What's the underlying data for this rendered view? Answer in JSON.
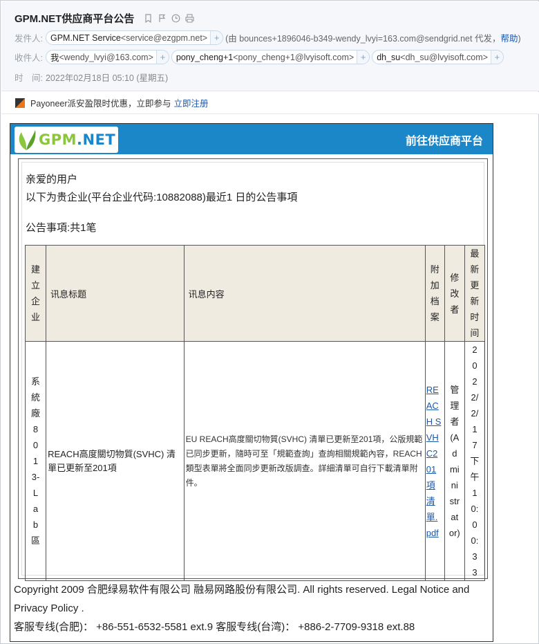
{
  "subject": "GPM.NET供应商平台公告",
  "header": {
    "from_label": "发件人:",
    "from": {
      "name": "GPM.NET Service",
      "email": "<service@ezgpm.net>"
    },
    "via_text": "(由 bounces+1896046-b349-wendy_lvyi=163.com@sendgrid.net 代发，",
    "help_link": "帮助",
    "via_close": ")",
    "to_label": "收件人:",
    "recipients": [
      {
        "name": "我",
        "email": "<wendy_lvyi@163.com>"
      },
      {
        "name": "pony_cheng+1",
        "email": "<pony_cheng+1@lvyisoft.com>"
      },
      {
        "name": "dh_su",
        "email": "<dh_su@lvyisoft.com>"
      }
    ],
    "time_label": "时　间:",
    "time_value": "2022年02月18日 05:10 (星期五)"
  },
  "promo": {
    "text": "Payoneer派安盈限时优惠，立即参与",
    "link": "立即注册"
  },
  "banner": {
    "logo_text_a": "GPM",
    "logo_text_b": ".NET",
    "go_label": "前往供应商平台"
  },
  "body": {
    "greeting": "亲爱的用户",
    "intro": "以下为贵企业(平台企业代码:10882088)最近1 日的公告事項",
    "count": "公告事項:共1笔"
  },
  "table": {
    "headers": [
      "建立企业",
      "讯息标题",
      "讯息内容",
      "附加档案",
      "修改者",
      "最新更新时间"
    ],
    "row": {
      "company": "系統廠8013-Lab區",
      "title": "REACH高度關切物質(SVHC) 清單已更新至201項",
      "content": "EU REACH高度關切物質(SVHC) 清單已更新至201項，公版規範已同步更新，隨時可至「規範查詢」查詢相關規範內容，REACH類型表單將全面同步更新改版調查。詳細清單可自行下載清單附件。",
      "attachment": "REACH SVHC201項清單.pdf",
      "modifier": "管理者(Administrator)",
      "updated": "2022/2/17 下午10:00:33"
    }
  },
  "footer": {
    "copyright": "Copyright 2009 合肥绿易软件有限公司 融易网路股份有限公司. All rights reserved. Legal Notice and Privacy Policy .",
    "service": "客服专线(合肥)：  +86-551-6532-5581 ext.9 客服专线(台湾)：  +886-2-7709-9318 ext.88"
  }
}
